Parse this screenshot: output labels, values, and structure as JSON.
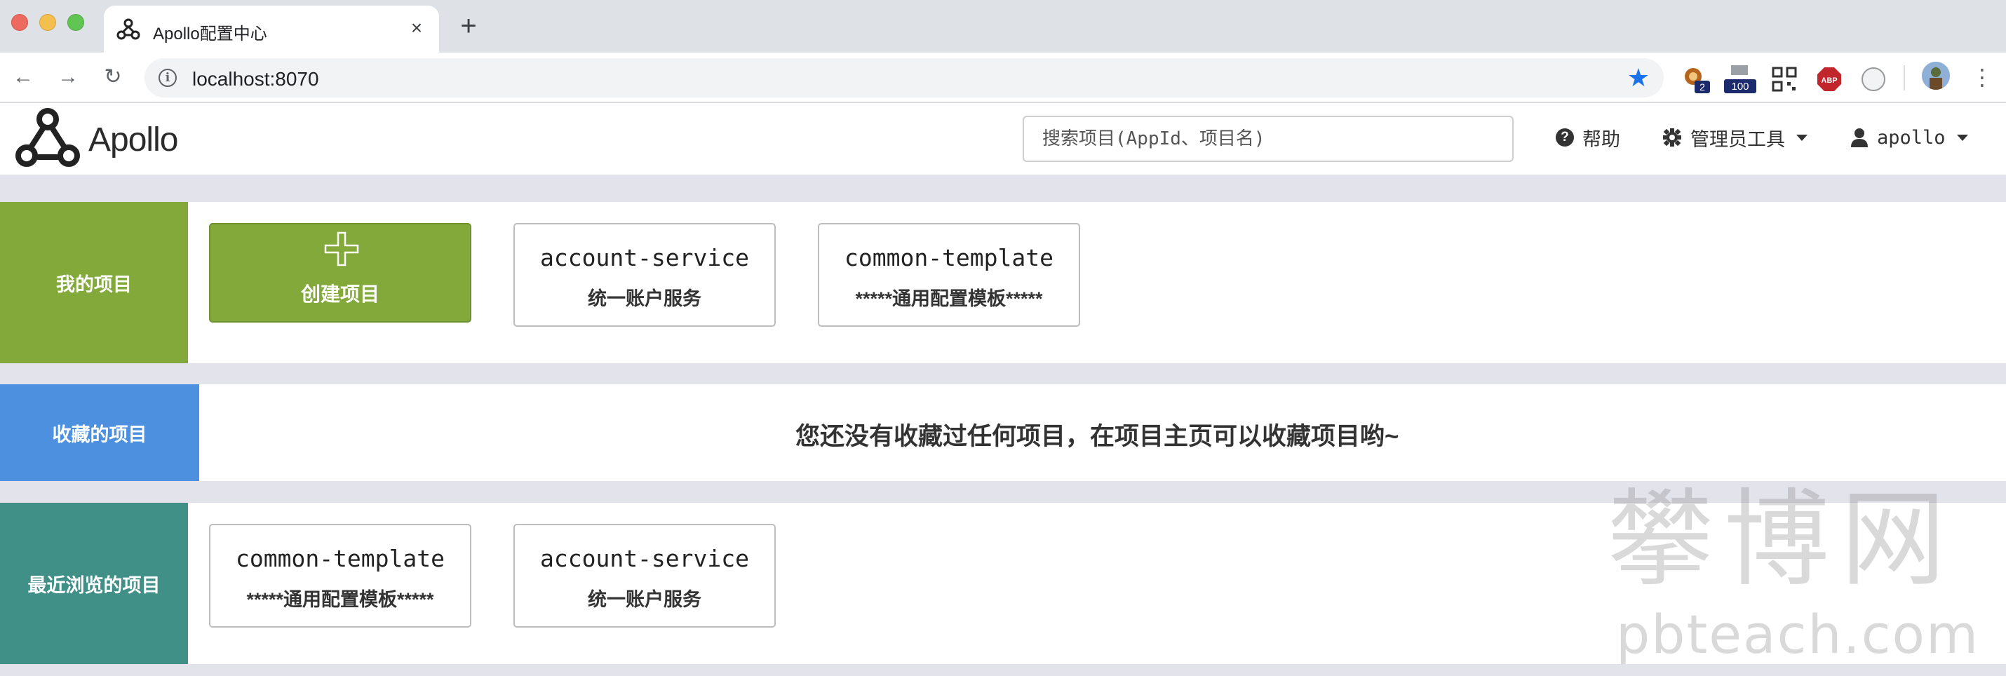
{
  "browser": {
    "tab_title": "Apollo配置中心",
    "url": "localhost:8070",
    "extensions": [
      {
        "icon": "extension-badge-icon",
        "badge": "2"
      },
      {
        "icon": "extension-counter-icon",
        "badge": "100"
      },
      {
        "icon": "qr-code-icon",
        "badge": ""
      },
      {
        "icon": "adblock-plus-icon",
        "badge": "ABP"
      },
      {
        "icon": "compass-icon",
        "badge": ""
      }
    ],
    "accent_color": "#1a73e8"
  },
  "header": {
    "logo_text": "Apollo",
    "search_placeholder": "搜索项目(AppId、项目名)",
    "help_label": "帮助",
    "admin_label": "管理员工具",
    "user_label": "apollo"
  },
  "sections": {
    "mine": {
      "label": "我的项目",
      "color": "#82a93a",
      "create_label": "创建项目",
      "apps": [
        {
          "id": "account-service",
          "name": "统一账户服务"
        },
        {
          "id": "common-template",
          "name": "*****通用配置模板*****"
        }
      ]
    },
    "favorites": {
      "label": "收藏的项目",
      "color": "#4d90df",
      "empty_message": "您还没有收藏过任何项目，在项目主页可以收藏项目哟~"
    },
    "recent": {
      "label": "最近浏览的项目",
      "color": "#419088",
      "apps": [
        {
          "id": "common-template",
          "name": "*****通用配置模板*****"
        },
        {
          "id": "account-service",
          "name": "统一账户服务"
        }
      ]
    }
  },
  "watermark": {
    "cn": "攀博网",
    "en": "pbteach.com"
  }
}
